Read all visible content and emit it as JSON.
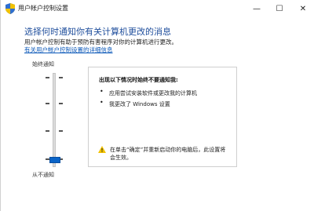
{
  "window": {
    "title": "用户帐户控制设置",
    "minimize_glyph": "—",
    "maximize_glyph": "☐",
    "close_glyph": "✕"
  },
  "main": {
    "heading": "选择何时通知你有关计算机更改的消息",
    "description": "用户帐户控制有助于预防有害程序对你的计算机进行更改。",
    "help_link": "有关用户帐户控制设置的详细信息"
  },
  "slider": {
    "top_label": "始终通知",
    "bottom_label": "从不通知",
    "levels": 4,
    "selected_level": 1,
    "accent_color": "#0a64c8"
  },
  "info": {
    "title": "出现以下情况时始终不要通知我:",
    "bullets": [
      "应用尝试安装软件或更改我的计算机",
      "我更改了 Windows 设置"
    ],
    "warning": "在单击“确定”并重新启动你的电脑后，此设置将会生效。"
  },
  "icons": {
    "title_icon": "shield-icon",
    "warning_icon": "warning-icon"
  },
  "colors": {
    "heading": "#1f4e9c",
    "link": "#0a57b8",
    "warning": "#f2c200"
  }
}
